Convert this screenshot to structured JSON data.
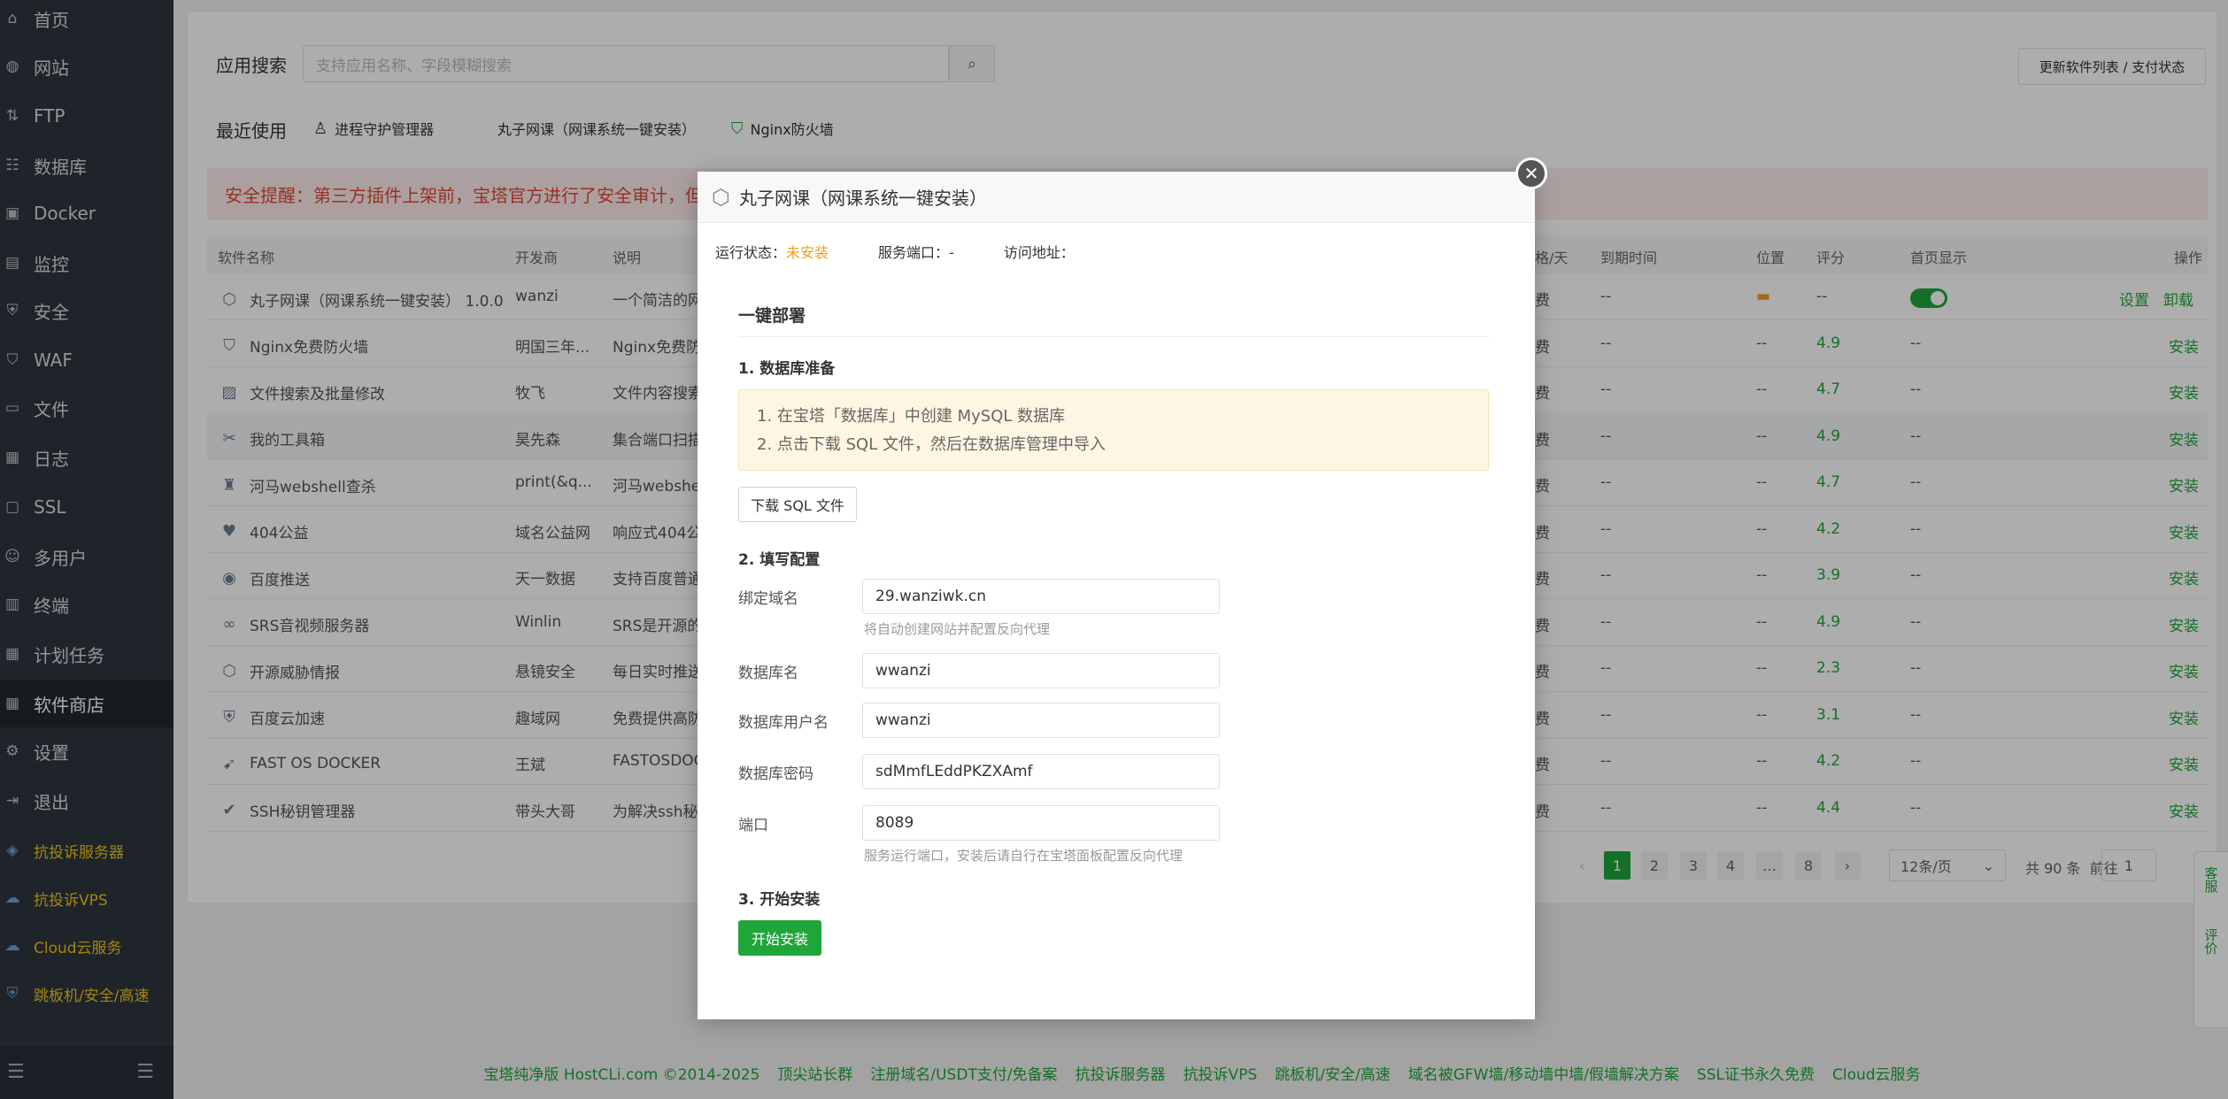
{
  "sidebar": {
    "items": [
      {
        "label": "首页",
        "icon": "home-icon",
        "glyph": "⌂"
      },
      {
        "label": "网站",
        "icon": "globe-icon",
        "glyph": "◍"
      },
      {
        "label": "FTP",
        "icon": "ftp-icon",
        "glyph": "⇅"
      },
      {
        "label": "数据库",
        "icon": "database-icon",
        "glyph": "☷"
      },
      {
        "label": "Docker",
        "icon": "docker-icon",
        "glyph": "▣"
      },
      {
        "label": "监控",
        "icon": "monitor-icon",
        "glyph": "▤"
      },
      {
        "label": "安全",
        "icon": "shield-icon",
        "glyph": "⛨"
      },
      {
        "label": "WAF",
        "icon": "waf-icon",
        "glyph": "⛉"
      },
      {
        "label": "文件",
        "icon": "folder-icon",
        "glyph": "▭"
      },
      {
        "label": "日志",
        "icon": "log-icon",
        "glyph": "▦"
      },
      {
        "label": "SSL",
        "icon": "ssl-icon",
        "glyph": "▢"
      },
      {
        "label": "多用户",
        "icon": "users-icon",
        "glyph": "☺"
      },
      {
        "label": "终端",
        "icon": "terminal-icon",
        "glyph": "▥"
      },
      {
        "label": "计划任务",
        "icon": "calendar-icon",
        "glyph": "▦"
      },
      {
        "label": "软件商店",
        "icon": "grid-icon",
        "glyph": "▦"
      },
      {
        "label": "设置",
        "icon": "gear-icon",
        "glyph": "⚙"
      },
      {
        "label": "退出",
        "icon": "logout-icon",
        "glyph": "⇥"
      }
    ],
    "promos": [
      {
        "label": "抗投诉服务器",
        "icon": "layers-icon",
        "glyph": "◈"
      },
      {
        "label": "抗投诉VPS",
        "icon": "cloud-icon",
        "glyph": "☁"
      },
      {
        "label": "Cloud云服务",
        "icon": "cloud-icon",
        "glyph": "☁"
      },
      {
        "label": "跳板机/安全/高速",
        "icon": "shield-icon",
        "glyph": "⛨"
      }
    ]
  },
  "store": {
    "search_label": "应用搜索",
    "search_placeholder": "支持应用名称、字段模糊搜索",
    "update_button": "更新软件列表 / 支付状态",
    "recent_label": "最近使用",
    "recent": [
      "进程守护管理器",
      "丸子网课（网课系统一键安装）",
      "Nginx防火墙"
    ],
    "alert": "安全提醒：第三方插件上架前，宝塔官方进行了安全审计，但可能"
  },
  "table": {
    "headers": {
      "name": "软件名称",
      "dev": "开发商",
      "desc": "说明",
      "price": "格/天",
      "expire": "到期时间",
      "location": "位置",
      "score": "评分",
      "home": "首页显示",
      "ops": "操作"
    },
    "rows": [
      {
        "name": "丸子网课（网课系统一键安装）  1.0.0",
        "dev": "wanzi",
        "desc": "一个简洁的网",
        "price": "费",
        "expire": "--",
        "location": "",
        "score": "--",
        "home": "",
        "op": "设置",
        "op2": "卸载",
        "icon": "cube-icon",
        "glyph": "⬡"
      },
      {
        "name": "Nginx免费防火墙",
        "dev": "明国三年...",
        "desc": "Nginx免费防",
        "price": "费",
        "expire": "--",
        "location": "--",
        "score": "4.9",
        "home": "--",
        "op": "安装",
        "icon": "waf-icon",
        "glyph": "⛉"
      },
      {
        "name": "文件搜索及批量修改",
        "dev": "牧飞",
        "desc": "文件内容搜索",
        "price": "费",
        "expire": "--",
        "location": "--",
        "score": "4.7",
        "home": "--",
        "op": "安装",
        "icon": "image-icon",
        "glyph": "▨"
      },
      {
        "name": "我的工具箱",
        "dev": "昊先森",
        "desc": "集合端口扫描",
        "price": "费",
        "expire": "--",
        "location": "--",
        "score": "4.9",
        "home": "--",
        "op": "安装",
        "icon": "tools-icon",
        "glyph": "✂"
      },
      {
        "name": "河马webshell查杀",
        "dev": "print(&q...",
        "desc": "河马webshel",
        "price": "费",
        "expire": "--",
        "location": "--",
        "score": "4.7",
        "home": "--",
        "op": "安装",
        "icon": "hippo-icon",
        "glyph": "♜"
      },
      {
        "name": "404公益",
        "dev": "域名公益网",
        "desc": "响应式404公",
        "price": "费",
        "expire": "--",
        "location": "--",
        "score": "4.2",
        "home": "--",
        "op": "安装",
        "icon": "heart-icon",
        "glyph": "♥"
      },
      {
        "name": "百度推送",
        "dev": "天一数据",
        "desc": "支持百度普通",
        "price": "费",
        "expire": "--",
        "location": "--",
        "score": "3.9",
        "home": "--",
        "op": "安装",
        "icon": "globe-icon",
        "glyph": "◉"
      },
      {
        "name": "SRS音视频服务器",
        "dev": "Winlin",
        "desc": "SRS是开源的",
        "price": "费",
        "expire": "--",
        "location": "--",
        "score": "4.9",
        "home": "--",
        "op": "安装",
        "icon": "link-icon",
        "glyph": "∞"
      },
      {
        "name": "开源威胁情报",
        "dev": "悬镜安全",
        "desc": "每日实时推送",
        "price": "费",
        "expire": "--",
        "location": "--",
        "score": "2.3",
        "home": "--",
        "op": "安装",
        "icon": "cube-icon",
        "glyph": "⬡"
      },
      {
        "name": "百度云加速",
        "dev": "趣域网",
        "desc": "免费提供高防",
        "price": "费",
        "expire": "--",
        "location": "--",
        "score": "3.1",
        "home": "--",
        "op": "安装",
        "icon": "shield-icon",
        "glyph": "⛨"
      },
      {
        "name": "FAST OS DOCKER",
        "dev": "王斌",
        "desc": "FASTOSDOC",
        "price": "费",
        "expire": "--",
        "location": "--",
        "score": "4.2",
        "home": "--",
        "op": "安装",
        "icon": "arrow-icon",
        "glyph": "➹"
      },
      {
        "name": "SSH秘钥管理器",
        "dev": "带头大哥",
        "desc": "为解决ssh秘",
        "price": "费",
        "expire": "--",
        "location": "--",
        "score": "4.4",
        "home": "--",
        "op": "安装",
        "icon": "check-circle-icon",
        "glyph": "✔"
      }
    ]
  },
  "pager": {
    "prev": "‹",
    "next": "›",
    "pages": [
      "1",
      "2",
      "3",
      "4",
      "…",
      "8"
    ],
    "per_page": "12条/页",
    "total": "共 90 条",
    "goto_label": "前往",
    "goto_value": "1"
  },
  "footer": {
    "links": [
      "宝塔纯净版 HostCLi.com ©2014-2025",
      "顶尖站长群",
      "注册域名/USDT支付/免备案",
      "抗投诉服务器",
      "抗投诉VPS",
      "跳板机/安全/高速",
      "域名被GFW墙/移动墙中墙/假墙解决方案",
      "SSL证书永久免费",
      "Cloud云服务"
    ]
  },
  "float": {
    "service": "客服",
    "review": "评价"
  },
  "modal": {
    "title": "丸子网课（网课系统一键安装）",
    "status_label": "运行状态：",
    "status_value": "未安装",
    "port_label": "服务端口：",
    "port_value": "-",
    "url_label": "访问地址：",
    "url_value": "",
    "section_title": "一键部署",
    "step1_title": "1. 数据库准备",
    "step1_tip1": "1. 在宝塔「数据库」中创建 MySQL 数据库",
    "step1_tip2": "2. 点击下载 SQL 文件，然后在数据库管理中导入",
    "download_button": "下载 SQL 文件",
    "step2_title": "2. 填写配置",
    "domain_label": "绑定域名",
    "domain_value": "29.wanziwk.cn",
    "domain_help": "将自动创建网站并配置反向代理",
    "dbname_label": "数据库名",
    "dbname_value": "wwanzi",
    "dbuser_label": "数据库用户名",
    "dbuser_value": "wwanzi",
    "dbpass_label": "数据库密码",
    "dbpass_value": "sdMmfLEddPKZXAmf",
    "port_field_label": "端口",
    "port_field_value": "8089",
    "port_help": "服务运行端口，安装后请自行在宝塔面板配置反向代理",
    "step3_title": "3. 开始安装",
    "install_button": "开始安装"
  },
  "colors": {
    "accent": "#20a53a",
    "sidebar": "#2f3640",
    "warning": "#f0a020",
    "alert": "#e0473a"
  }
}
